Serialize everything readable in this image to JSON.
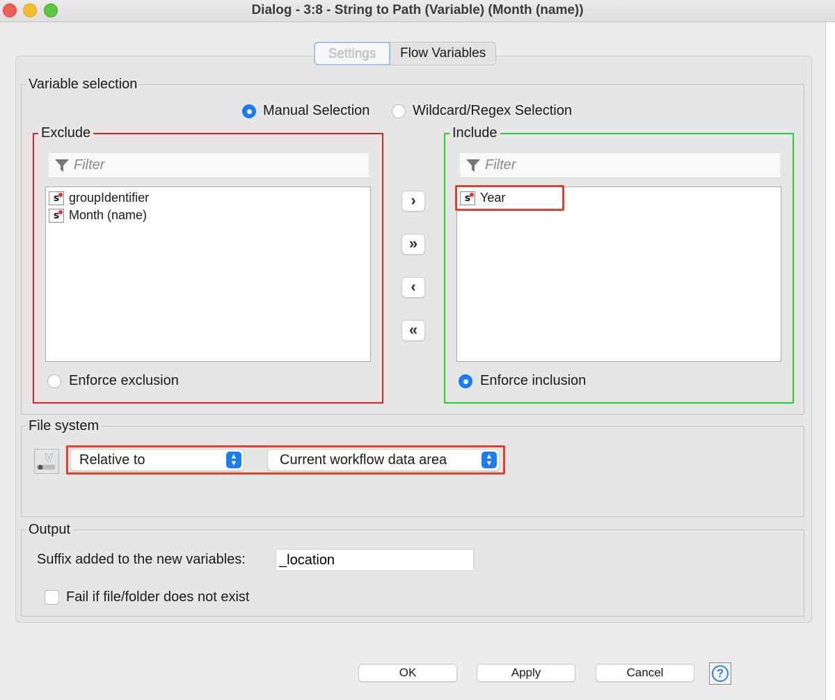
{
  "window": {
    "title": "Dialog - 3:8 - String to Path (Variable) (Month (name))"
  },
  "tabs": [
    "Settings",
    "Flow Variables"
  ],
  "variable_selection": {
    "legend": "Variable selection",
    "mode_options": [
      "Manual Selection",
      "Wildcard/Regex Selection"
    ],
    "selected_mode": "Manual Selection",
    "exclude": {
      "legend": "Exclude",
      "filter_placeholder": "Filter",
      "items": [
        "groupIdentifier",
        "Month (name)"
      ],
      "enforce_label": "Enforce exclusion",
      "enforce_selected": false
    },
    "include": {
      "legend": "Include",
      "filter_placeholder": "Filter",
      "items": [
        "Year"
      ],
      "enforce_label": "Enforce inclusion",
      "enforce_selected": true
    },
    "move_buttons": {
      "add": "›",
      "add_all": "»",
      "remove": "‹",
      "remove_all": "«"
    },
    "item_type_icon": "s"
  },
  "file_system": {
    "legend": "File system",
    "variable_button_icon": "flow-variable-icon",
    "mode_value": "Relative to",
    "location_value": "Current workflow data area"
  },
  "output": {
    "legend": "Output",
    "suffix_label": "Suffix added to the new variables:",
    "suffix_value": "_location",
    "fail_label": "Fail if file/folder does not exist",
    "fail_checked": false
  },
  "buttons": {
    "ok": "OK",
    "apply": "Apply",
    "cancel": "Cancel",
    "help_icon": "?"
  },
  "colors": {
    "exclude_border": "#e0211b",
    "include_border": "#2bd12b",
    "highlight_box": "#e0412f",
    "accent": "#1c7cf4"
  }
}
